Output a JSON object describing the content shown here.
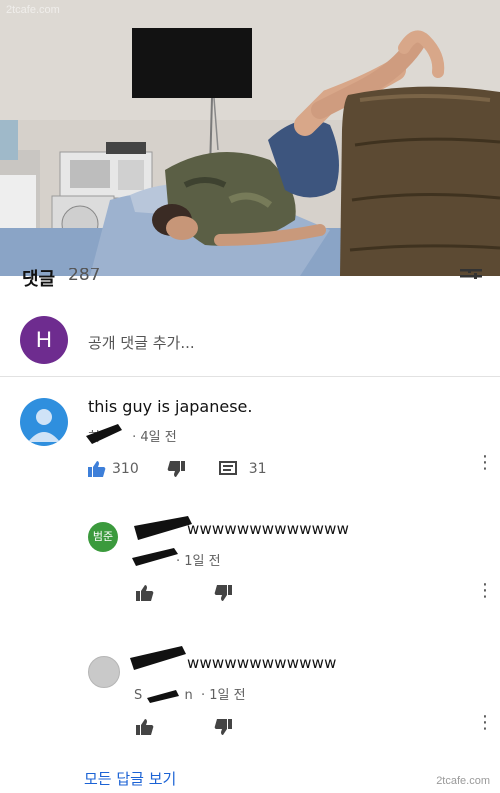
{
  "watermark_top": "2tcafe.com",
  "watermark_bottom": "2tcafe.com",
  "comments": {
    "title": "댓글",
    "count": "287"
  },
  "add_comment": {
    "avatar_letter": "H",
    "placeholder": "공개 댓글 추가...",
    "avatar_color": "#6e2c8f"
  },
  "top_comment": {
    "text": "this guy is japanese.",
    "author_visible": "히",
    "time": "· 4일 전",
    "likes": "310",
    "replies": "31",
    "avatar_color": "#2f8fde"
  },
  "replies": [
    {
      "avatar_text": "범준",
      "avatar_color": "#3b9a3d",
      "text": "wwwwwwwwwwwww",
      "time": "· 1일 전"
    },
    {
      "avatar_text": "",
      "avatar_color": "#c9c9c9",
      "text": "wwwwwwwwwwww",
      "author_fragment_start": "S",
      "author_fragment_end": "n",
      "time": "· 1일 전"
    }
  ],
  "view_all_replies": "모든 답글 보기",
  "accent_color": "#1c63d5"
}
